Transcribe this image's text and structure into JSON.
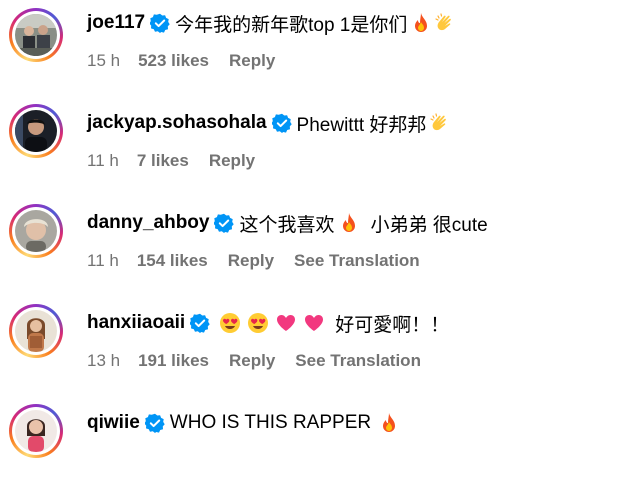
{
  "comments": [
    {
      "username": "joe117",
      "text_parts": [
        "今年我的新年歌top 1是你们"
      ],
      "emojis": [
        "fire-emoji",
        "clapping-hands-emoji"
      ],
      "time": "15 h",
      "likes": "523 likes",
      "reply": "Reply"
    },
    {
      "username": "jackyap.sohasohala",
      "text_parts": [
        "Phewittt 好邦邦"
      ],
      "emojis": [
        "clapping-hands-emoji"
      ],
      "time": "11 h",
      "likes": "7 likes",
      "reply": "Reply"
    },
    {
      "username": "danny_ahboy",
      "text_parts": [
        "这个我喜欢",
        "小弟弟 很cute"
      ],
      "emojis": [
        "fire-emoji"
      ],
      "time": "11 h",
      "likes": "154 likes",
      "reply": "Reply",
      "see_translation": "See Translation"
    },
    {
      "username": "hanxiiaoaii",
      "text_parts": [
        "好可愛啊！！"
      ],
      "emojis": [
        "heart-eyes-emoji",
        "heart-eyes-emoji",
        "pink-heart-emoji",
        "pink-heart-emoji"
      ],
      "time": "13 h",
      "likes": "191 likes",
      "reply": "Reply",
      "see_translation": "See Translation"
    },
    {
      "username": "qiwiie",
      "text_parts": [
        "WHO IS THIS RAPPER"
      ],
      "emojis": [
        "fire-emoji"
      ]
    }
  ],
  "colors": {
    "verified_badge": "#0095f6",
    "meta_text": "#737373"
  }
}
